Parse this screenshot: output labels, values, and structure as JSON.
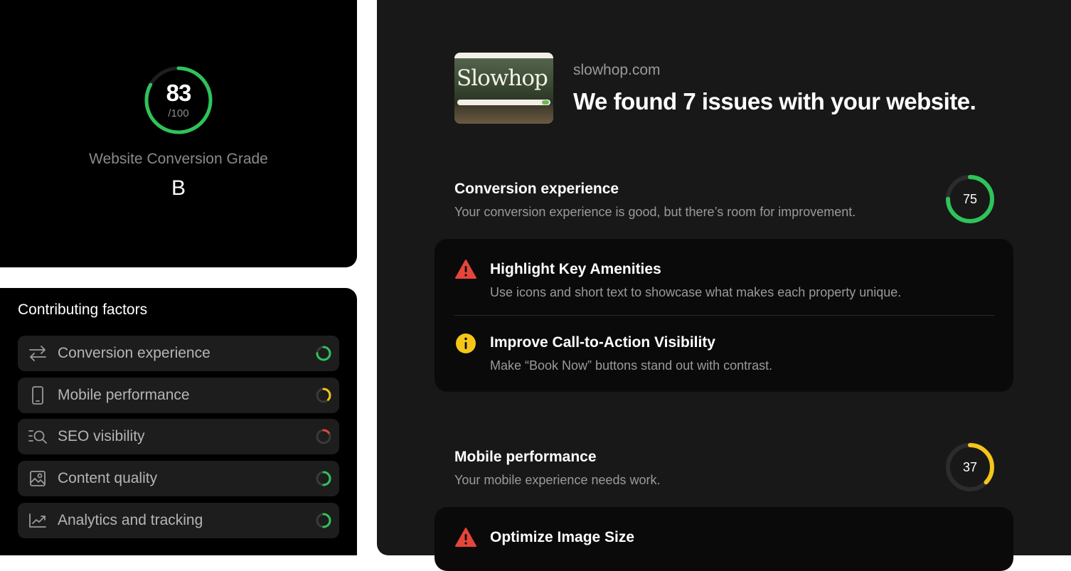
{
  "score_card": {
    "score": "83",
    "max": "/100",
    "score_fraction": 0.83,
    "label": "Website Conversion Grade",
    "grade": "B",
    "ring_color": "#2fc35a"
  },
  "factors": {
    "title": "Contributing factors",
    "items": [
      {
        "label": "Conversion experience",
        "icon": "arrows-swap-icon",
        "level": 0.75,
        "color": "#2fc35a"
      },
      {
        "label": "Mobile performance",
        "icon": "mobile-icon",
        "level": 0.37,
        "color": "#f5c518"
      },
      {
        "label": "SEO visibility",
        "icon": "search-list-icon",
        "level": 0.15,
        "color": "#e5453a"
      },
      {
        "label": "Content quality",
        "icon": "image-icon",
        "level": 0.5,
        "color": "#2fc35a"
      },
      {
        "label": "Analytics and tracking",
        "icon": "chart-trend-icon",
        "level": 0.5,
        "color": "#2fc35a"
      }
    ]
  },
  "report": {
    "thumbnail_logo": "Slowhop",
    "domain": "slowhop.com",
    "headline": "We found 7 issues with your website.",
    "sections": [
      {
        "title": "Conversion experience",
        "description": "Your conversion experience is good, but there’s room for improvement.",
        "score": "75",
        "score_fraction": 0.75,
        "color": "#2fc35a",
        "issues": [
          {
            "title": "Highlight Key Amenities",
            "description": "Use icons and short text to showcase what makes each property unique.",
            "icon": "warning-icon",
            "severity_color": "#e5453a"
          },
          {
            "title": "Improve Call-to-Action Visibility",
            "description": "Make “Book Now” buttons stand out with contrast.",
            "icon": "info-icon",
            "severity_color": "#f5c518"
          }
        ]
      },
      {
        "title": "Mobile performance",
        "description": "Your mobile experience needs work.",
        "score": "37",
        "score_fraction": 0.37,
        "color": "#f5c518",
        "issues": [
          {
            "title": "Optimize Image Size",
            "description": "",
            "icon": "warning-icon",
            "severity_color": "#e5453a"
          }
        ]
      }
    ]
  }
}
